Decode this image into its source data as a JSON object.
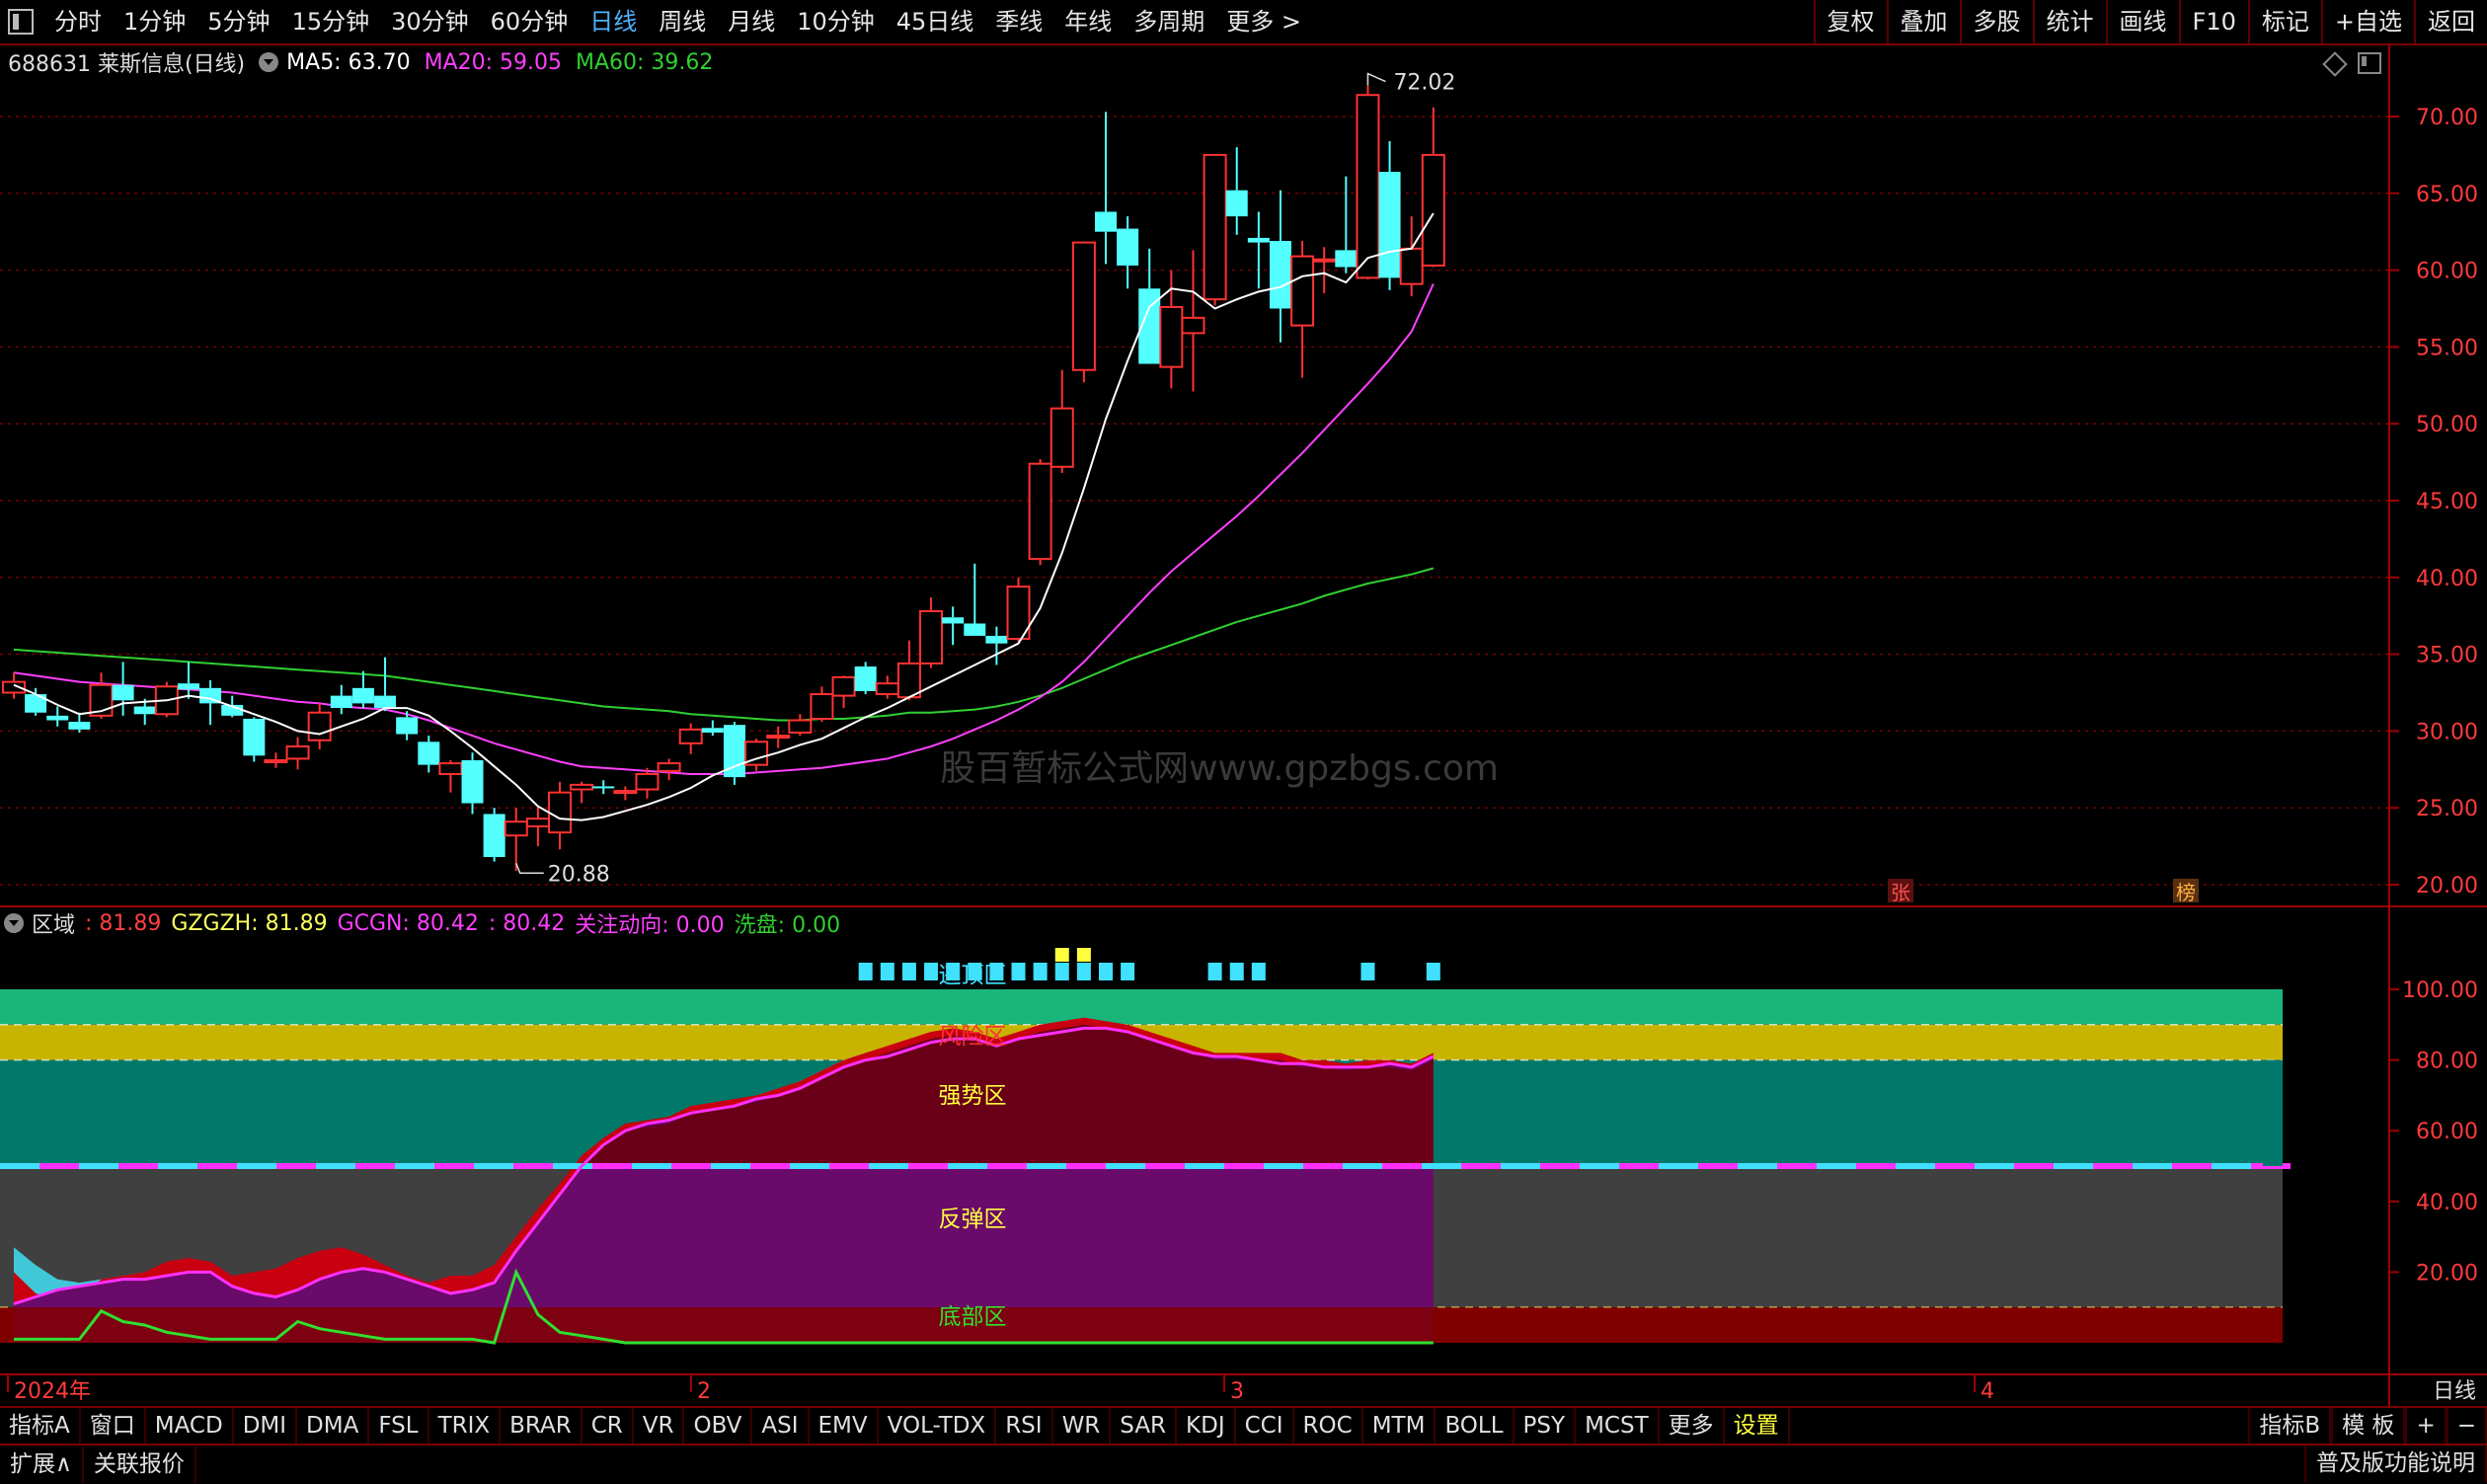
{
  "toolbar": {
    "periods": [
      "分时",
      "1分钟",
      "5分钟",
      "15分钟",
      "30分钟",
      "60分钟",
      "日线",
      "周线",
      "月线",
      "10分钟",
      "45日线",
      "季线",
      "年线",
      "多周期",
      "更多 >"
    ],
    "active_period": "日线",
    "right_buttons": [
      "复权",
      "叠加",
      "多股",
      "统计",
      "画线",
      "F10",
      "标记",
      "+自选",
      "返回"
    ]
  },
  "stock": {
    "title": "688631 莱斯信息(日线)",
    "ma5": "MA5: 63.70",
    "ma20": "MA20: 59.05",
    "ma60": "MA60: 39.62",
    "high_label": "72.02",
    "low_label": "20.88",
    "watermark": "股百暂标公式网www.gpzbgs.com",
    "badges": [
      "张",
      "榜"
    ]
  },
  "price_axis": [
    "70.00",
    "65.00",
    "60.00",
    "55.00",
    "50.00",
    "45.00",
    "40.00",
    "35.00",
    "30.00",
    "25.00",
    "20.00"
  ],
  "indicator": {
    "name": "区域",
    "v1": ": 81.89",
    "gzgzh": "GZGZH: 81.89",
    "gcgn": "GCGN: 80.42",
    "v2": ": 80.42",
    "gzdx": "关注动向: 0.00",
    "xp": "洗盘: 0.00",
    "zones": [
      "逃顶区",
      "风险区",
      "强势区",
      "反弹区",
      "底部区"
    ],
    "axis": [
      "100.00",
      "80.00",
      "60.00",
      "40.00",
      "20.00"
    ]
  },
  "date_axis": [
    "2024年",
    "2",
    "3",
    "4"
  ],
  "date_axis_right": "日线",
  "tabs": [
    "指标A",
    "窗口",
    "MACD",
    "DMI",
    "DMA",
    "FSL",
    "TRIX",
    "BRAR",
    "CR",
    "VR",
    "OBV",
    "ASI",
    "EMV",
    "VOL-TDX",
    "RSI",
    "WR",
    "SAR",
    "KDJ",
    "CCI",
    "ROC",
    "MTM",
    "BOLL",
    "PSY",
    "MCST",
    "更多",
    "设置"
  ],
  "tabs_right": [
    "指标B",
    "模 板",
    "+",
    "−"
  ],
  "bottom": {
    "left": [
      "扩展∧",
      "关联报价"
    ],
    "right": "普及版功能说明"
  },
  "colors": {
    "up": "#ff3232",
    "down": "#54ffff",
    "ma5": "#ffffff",
    "ma20": "#ff40ff",
    "ma60": "#30d030",
    "frame": "#a00000"
  },
  "candles": [
    [
      32.5,
      33.8,
      32.1,
      33.2
    ],
    [
      32.4,
      32.8,
      31.0,
      31.2
    ],
    [
      31.0,
      31.6,
      30.3,
      30.7
    ],
    [
      30.6,
      31.2,
      29.9,
      30.1
    ],
    [
      31.0,
      33.8,
      30.8,
      33.0
    ],
    [
      33.0,
      34.5,
      31.0,
      32.0
    ],
    [
      31.6,
      32.1,
      30.4,
      31.1
    ],
    [
      31.1,
      33.2,
      30.9,
      32.9
    ],
    [
      33.1,
      34.5,
      32.1,
      32.7
    ],
    [
      32.8,
      33.3,
      30.4,
      31.8
    ],
    [
      31.7,
      32.3,
      30.9,
      31.0
    ],
    [
      30.8,
      30.9,
      28.0,
      28.4
    ],
    [
      28.0,
      28.6,
      27.6,
      28.1
    ],
    [
      28.2,
      29.6,
      27.5,
      29.0
    ],
    [
      29.4,
      31.8,
      28.8,
      31.2
    ],
    [
      32.3,
      33.0,
      31.1,
      31.5
    ],
    [
      32.8,
      33.9,
      31.5,
      31.8
    ],
    [
      32.3,
      34.8,
      31.3,
      31.5
    ],
    [
      30.9,
      31.3,
      29.4,
      29.8
    ],
    [
      29.3,
      29.7,
      27.3,
      27.8
    ],
    [
      27.2,
      28.1,
      26.0,
      27.9
    ],
    [
      28.1,
      28.6,
      24.6,
      25.3
    ],
    [
      24.6,
      25.0,
      21.5,
      21.8
    ],
    [
      23.2,
      25.0,
      20.9,
      24.1
    ],
    [
      23.8,
      25.1,
      22.5,
      24.3
    ],
    [
      23.4,
      26.7,
      22.3,
      26.0
    ],
    [
      26.2,
      26.7,
      25.3,
      26.5
    ],
    [
      26.4,
      26.8,
      25.9,
      26.3
    ],
    [
      26.0,
      26.4,
      25.5,
      26.1
    ],
    [
      26.2,
      27.6,
      25.6,
      27.2
    ],
    [
      27.4,
      28.2,
      26.8,
      27.9
    ],
    [
      29.2,
      30.5,
      28.5,
      30.1
    ],
    [
      30.2,
      30.7,
      29.7,
      29.9
    ],
    [
      30.4,
      30.6,
      26.5,
      27.0
    ],
    [
      27.8,
      29.5,
      27.4,
      29.3
    ],
    [
      29.6,
      30.3,
      28.9,
      29.7
    ],
    [
      29.9,
      31.1,
      29.7,
      30.7
    ],
    [
      30.8,
      32.9,
      30.6,
      32.4
    ],
    [
      32.3,
      33.6,
      31.5,
      33.5
    ],
    [
      34.2,
      34.5,
      32.4,
      32.6
    ],
    [
      32.4,
      33.6,
      32.1,
      33.1
    ],
    [
      32.2,
      35.9,
      32.0,
      34.4
    ],
    [
      34.4,
      38.7,
      34.1,
      37.8
    ],
    [
      37.4,
      38.1,
      35.6,
      37.0
    ],
    [
      37.0,
      40.9,
      36.4,
      36.2
    ],
    [
      36.2,
      36.8,
      34.3,
      35.7
    ],
    [
      36.0,
      40.0,
      35.8,
      39.4
    ],
    [
      41.2,
      47.7,
      40.8,
      47.4
    ],
    [
      47.2,
      53.5,
      46.8,
      51.0
    ],
    [
      53.5,
      61.5,
      52.7,
      61.8
    ],
    [
      63.8,
      70.3,
      60.4,
      62.5
    ],
    [
      62.7,
      63.5,
      58.8,
      60.3
    ],
    [
      58.8,
      61.4,
      55.1,
      53.9
    ],
    [
      53.7,
      60.0,
      52.3,
      57.6
    ],
    [
      55.9,
      61.3,
      52.1,
      56.9
    ],
    [
      58.1,
      61.5,
      57.7,
      67.5
    ],
    [
      65.2,
      68.0,
      62.3,
      63.5
    ],
    [
      62.1,
      63.8,
      58.8,
      61.8
    ],
    [
      61.9,
      65.2,
      55.3,
      57.5
    ],
    [
      56.4,
      61.9,
      53.0,
      60.9
    ],
    [
      60.6,
      61.5,
      58.5,
      60.7
    ],
    [
      61.3,
      66.1,
      59.8,
      60.2
    ],
    [
      59.5,
      72.0,
      59.4,
      71.4
    ],
    [
      66.4,
      68.4,
      58.7,
      59.5
    ],
    [
      59.1,
      63.5,
      58.3,
      61.4
    ],
    [
      60.3,
      70.6,
      60.2,
      67.5
    ]
  ],
  "ma5_line": [
    33.0,
    32.4,
    31.7,
    31.1,
    31.3,
    31.8,
    31.9,
    32.0,
    32.3,
    32.1,
    31.6,
    31.1,
    30.6,
    30.0,
    29.8,
    30.3,
    30.8,
    31.5,
    31.5,
    31.0,
    30.0,
    28.9,
    27.7,
    26.5,
    25.1,
    24.3,
    24.2,
    24.4,
    24.8,
    25.2,
    25.7,
    26.3,
    27.1,
    27.7,
    28.2,
    28.6,
    29.1,
    29.5,
    30.2,
    30.9,
    31.5,
    32.2,
    32.9,
    33.6,
    34.3,
    35.0,
    35.7,
    38.0,
    41.6,
    45.8,
    50.3,
    54.1,
    57.6,
    58.8,
    58.6,
    57.5,
    58.1,
    58.6,
    58.9,
    59.6,
    59.8,
    59.2,
    60.8,
    61.2,
    61.4,
    63.7
  ],
  "ma20_line": [
    33.8,
    33.6,
    33.4,
    33.2,
    33.1,
    33.0,
    32.9,
    32.8,
    32.7,
    32.6,
    32.5,
    32.3,
    32.1,
    31.9,
    31.8,
    31.6,
    31.5,
    31.4,
    31.1,
    30.7,
    30.2,
    29.7,
    29.2,
    28.8,
    28.4,
    28.0,
    27.7,
    27.6,
    27.5,
    27.4,
    27.3,
    27.2,
    27.2,
    27.2,
    27.3,
    27.4,
    27.5,
    27.6,
    27.8,
    28.0,
    28.2,
    28.6,
    29.0,
    29.5,
    30.1,
    30.7,
    31.4,
    32.2,
    33.2,
    34.5,
    36.0,
    37.5,
    39.0,
    40.4,
    41.6,
    42.8,
    44.0,
    45.3,
    46.7,
    48.1,
    49.6,
    51.1,
    52.6,
    54.2,
    56.0,
    59.1
  ],
  "ma60_line": [
    35.3,
    35.2,
    35.1,
    35.0,
    34.9,
    34.8,
    34.7,
    34.6,
    34.5,
    34.4,
    34.3,
    34.2,
    34.1,
    34.0,
    33.9,
    33.8,
    33.7,
    33.6,
    33.4,
    33.2,
    33.0,
    32.8,
    32.6,
    32.4,
    32.2,
    32.0,
    31.8,
    31.6,
    31.5,
    31.4,
    31.3,
    31.1,
    31.0,
    30.9,
    30.8,
    30.7,
    30.7,
    30.8,
    30.8,
    30.9,
    31.0,
    31.2,
    31.2,
    31.3,
    31.4,
    31.6,
    31.9,
    32.3,
    32.8,
    33.4,
    34.0,
    34.6,
    35.1,
    35.6,
    36.1,
    36.6,
    37.1,
    37.5,
    37.9,
    38.3,
    38.8,
    39.2,
    39.6,
    39.9,
    40.2,
    40.6
  ],
  "ind_red": [
    20,
    14,
    12,
    13,
    18,
    19,
    20,
    23,
    24,
    23,
    19,
    20,
    21,
    24,
    26,
    27,
    25,
    22,
    19,
    17,
    19,
    19,
    22,
    30,
    38,
    45,
    53,
    58,
    62,
    63,
    64,
    67,
    68,
    69,
    70,
    72,
    74,
    77,
    80,
    82,
    84,
    86,
    88,
    89,
    88,
    86,
    88,
    90,
    91,
    92,
    91,
    90,
    88,
    86,
    84,
    82,
    82,
    82,
    82,
    80,
    80,
    79,
    80,
    80,
    79,
    82
  ],
  "ind_cyan": [
    27,
    22,
    18,
    17,
    18,
    19,
    20,
    21,
    22,
    21,
    17,
    18,
    18,
    21,
    22,
    22,
    22,
    20,
    18,
    17,
    17,
    18,
    21,
    30,
    37,
    44,
    52,
    57,
    61,
    62,
    63,
    66,
    67,
    68,
    70,
    72,
    74,
    77,
    80,
    82,
    83,
    84,
    86,
    88,
    88,
    86,
    88,
    89,
    90,
    90,
    90,
    88,
    85,
    80,
    77,
    79,
    81,
    82,
    81,
    80,
    79,
    78,
    79,
    79,
    78,
    80
  ],
  "ind_mag": [
    11,
    13,
    15,
    16,
    17,
    18,
    18,
    19,
    20,
    20,
    16,
    14,
    13,
    15,
    18,
    20,
    21,
    20,
    18,
    16,
    14,
    15,
    17,
    26,
    34,
    42,
    50,
    56,
    60,
    62,
    63,
    65,
    66,
    67,
    69,
    70,
    72,
    75,
    78,
    80,
    81,
    83,
    85,
    86,
    86,
    84,
    86,
    87,
    88,
    89,
    89,
    88,
    86,
    84,
    82,
    81,
    81,
    80,
    79,
    79,
    78,
    78,
    78,
    79,
    78,
    81
  ],
  "ind_green": [
    1,
    1,
    1,
    1,
    9,
    6,
    5,
    3,
    2,
    1,
    1,
    1,
    1,
    6,
    4,
    3,
    2,
    1,
    1,
    1,
    1,
    1,
    0,
    20,
    8,
    3,
    2,
    1,
    0,
    0,
    0,
    0,
    0,
    0,
    0,
    0,
    0,
    0,
    0,
    0,
    0,
    0,
    0,
    0,
    0,
    0,
    0,
    0,
    0,
    0,
    0,
    0,
    0,
    0,
    0,
    0,
    0,
    0,
    0,
    0,
    0,
    0,
    0,
    0,
    0,
    0
  ]
}
